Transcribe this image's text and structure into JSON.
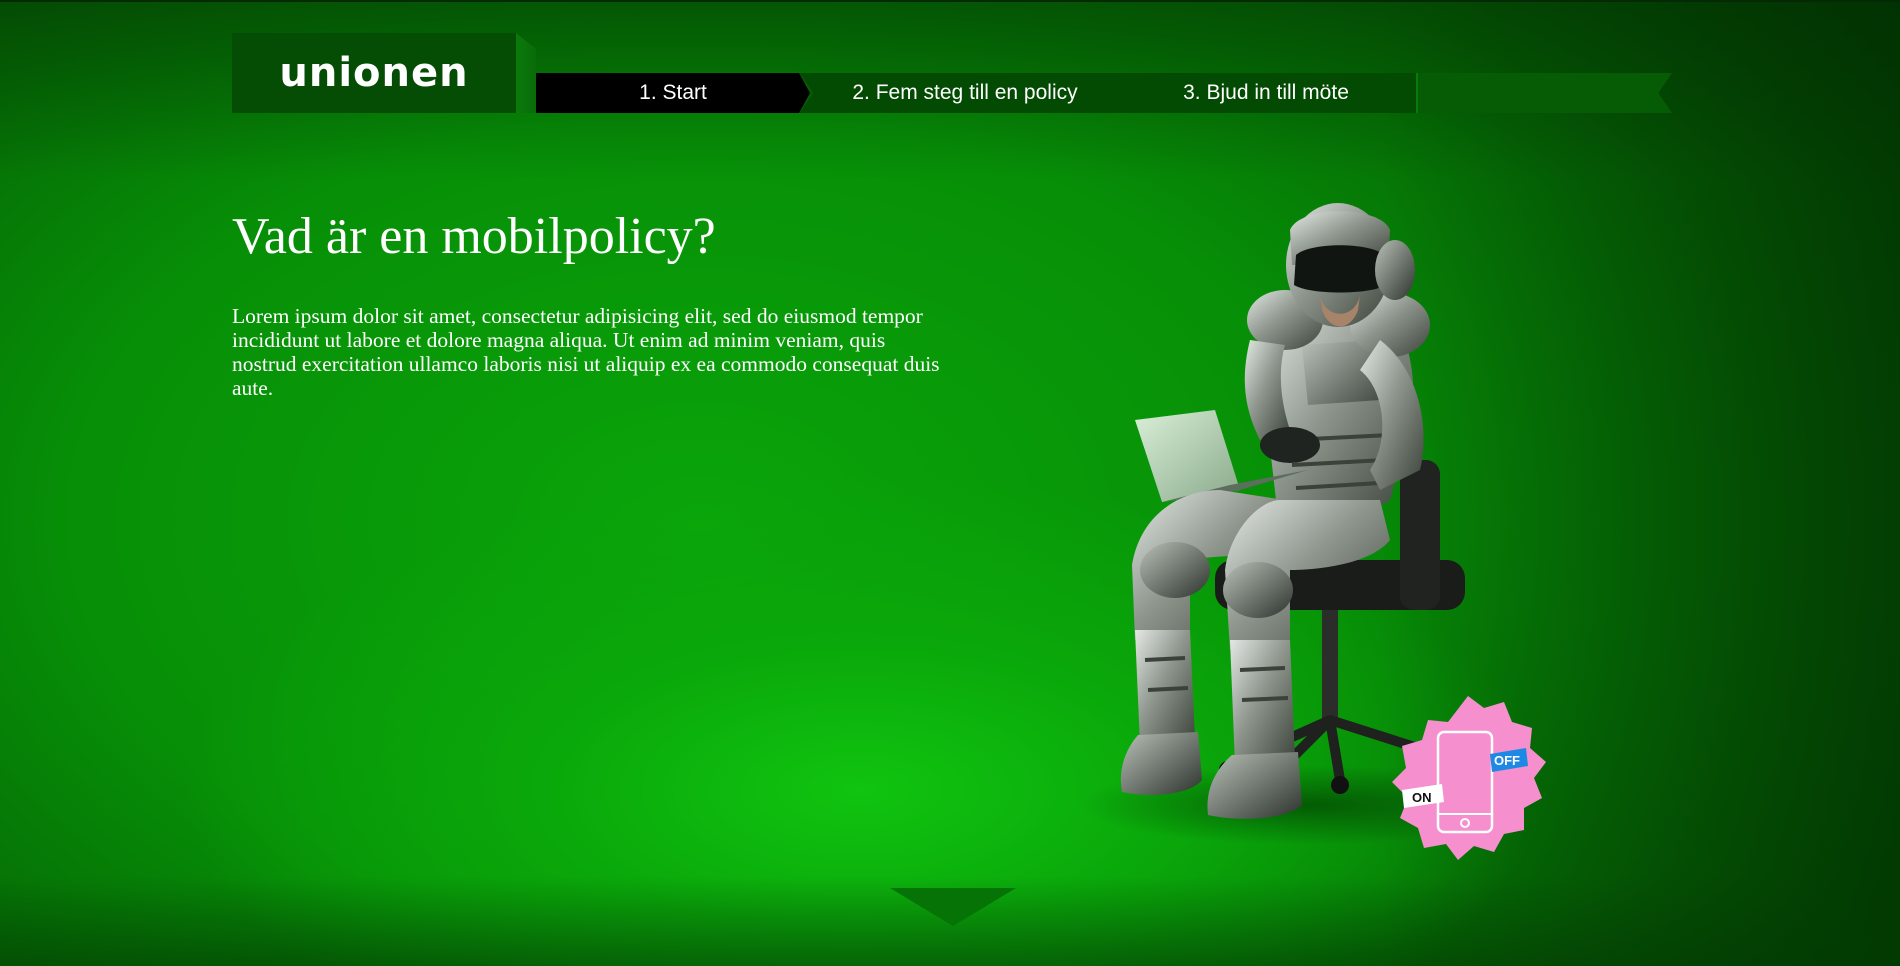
{
  "brand": {
    "logo_text": "unionen"
  },
  "nav": {
    "tabs": [
      {
        "label": "1. Start",
        "active": true
      },
      {
        "label": "2. Fem steg till en policy",
        "active": false
      },
      {
        "label": "3. Bjud in till möte",
        "active": false
      }
    ]
  },
  "main": {
    "title": "Vad är en mobilpolicy?",
    "body": "Lorem ipsum dolor sit amet, consectetur adipisicing elit, sed do eiusmod tempor incididunt ut labore et dolore magna aliqua. Ut enim ad minim veniam, quis nostrud exercitation ullamco laboris nisi ut aliquip ex ea commodo consequat duis aute."
  },
  "badge": {
    "on_label": "ON",
    "off_label": "OFF"
  },
  "colors": {
    "background_green": "#0aa50a",
    "nav_active": "#000000",
    "nav_inactive": "#034a03",
    "badge_pink": "#f58fce",
    "badge_off_blue": "#1e88e5"
  },
  "icons": {
    "scroll": "chevron-down-icon",
    "badge": "phone-icon"
  }
}
